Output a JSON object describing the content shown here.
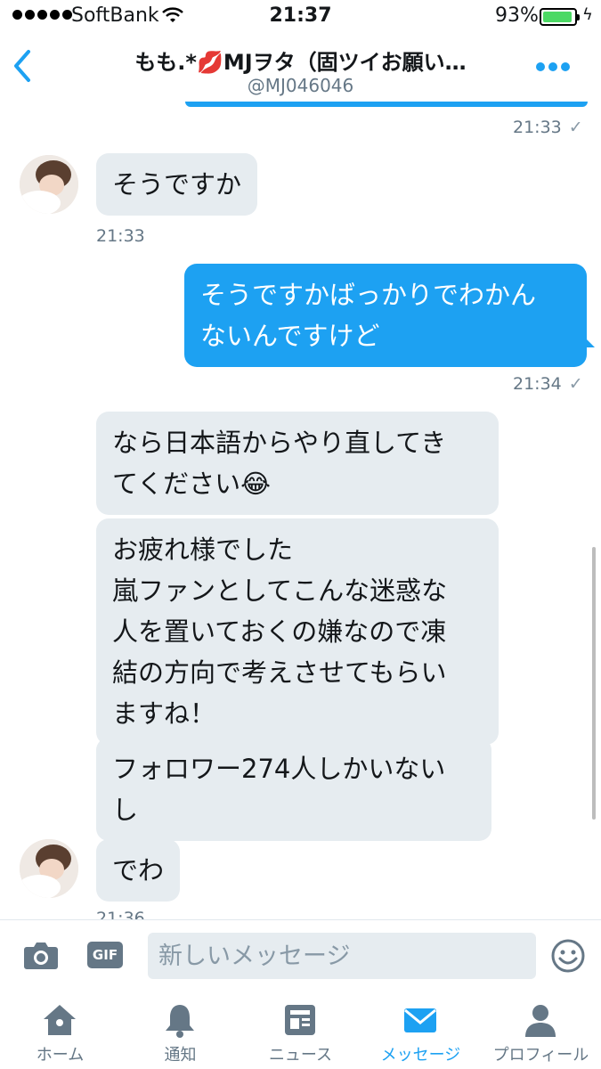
{
  "status_bar": {
    "carrier": "SoftBank",
    "time": "21:37",
    "battery": "93%",
    "battery_level": 0.93
  },
  "header": {
    "title": "もも.*💋MJヲタ（固ツイお願い…",
    "handle": "@MJ046046"
  },
  "messages": [
    {
      "direction": "out",
      "timestamp": "21:33"
    },
    {
      "direction": "in",
      "text": "そうですか",
      "timestamp": "21:33"
    },
    {
      "direction": "out",
      "lines": [
        "そうですかばっかりでわかん",
        "ないんですけど"
      ],
      "timestamp": "21:34"
    },
    {
      "direction": "in",
      "lines": [
        "なら日本語からやり直してき",
        "てください😂"
      ]
    },
    {
      "direction": "in",
      "lines": [
        "お疲れ様でした",
        "嵐ファンとしてこんな迷惑な",
        "人を置いておくの嫌なので凍",
        "結の方向で考えさせてもらい",
        "ますね！"
      ]
    },
    {
      "direction": "in",
      "lines": [
        "フォロワー274人しかいない",
        "し"
      ]
    },
    {
      "direction": "in",
      "text": "でわ",
      "timestamp": "21:36"
    }
  ],
  "composer": {
    "gif_label": "GIF",
    "placeholder": "新しいメッセージ"
  },
  "tabs": [
    {
      "label": "ホーム",
      "icon": "home-icon"
    },
    {
      "label": "通知",
      "icon": "bell-icon"
    },
    {
      "label": "ニュース",
      "icon": "news-icon"
    },
    {
      "label": "メッセージ",
      "icon": "envelope-icon",
      "active": true
    },
    {
      "label": "プロフィール",
      "icon": "person-icon"
    }
  ],
  "colors": {
    "accent": "#1da1f2",
    "bubble_in": "#e6ecf0",
    "meta_text": "#657786"
  }
}
